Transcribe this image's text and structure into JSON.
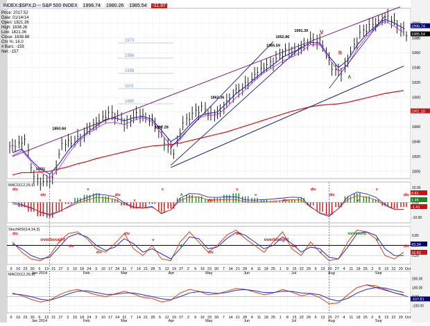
{
  "header": {
    "chart_title": "INDEX:$SPX,D -- S&P 500 INDEX",
    "toolbar_values": [
      "1996.74",
      "1980.26",
      "1985.54",
      "-11.97"
    ],
    "info_lines": [
      "Price: 2017.52",
      "Date: 01/14/14",
      "Open: 1821.36",
      "High: 1838.26",
      "Low: 1821.36",
      "Close: 1838.88",
      "Chr %: 16.0",
      "# Bars: -159",
      "Net: -157"
    ]
  },
  "colors": {
    "up_down_bars": "#000000",
    "ma_short": "#1f2fd0",
    "ma_mid": "#d02fd0",
    "ma_long": "#d01010",
    "channel": "#1a1a8a",
    "upper_trend": "#7a1a7a",
    "histogram_pos": "#1a8a1a",
    "histogram_neg": "#d01010",
    "macd_line": "#1f2fd0",
    "signal_line": "#e04010",
    "annotation_red": "#d01010",
    "annotation_green": "#1a8a1a",
    "annotation_black": "#000000",
    "fib_label": "#5b8fd0",
    "badge_bg": "#000080"
  },
  "chart_data": [
    {
      "type": "line",
      "panel": "price",
      "x_labels": [
        "9",
        "16",
        "23",
        "30",
        "6",
        "13",
        "21",
        "27",
        "3",
        "10",
        "18",
        "24",
        "3",
        "10",
        "17",
        "24",
        "31",
        "7",
        "14",
        "21",
        "28",
        "5",
        "12",
        "19",
        "27",
        "2",
        "9",
        "16",
        "23",
        "30",
        "7",
        "14",
        "21",
        "28",
        "4",
        "11",
        "18",
        "25",
        "1",
        "8",
        "15",
        "22",
        "29",
        "6",
        "13",
        "20",
        "27",
        "4",
        "11",
        "18",
        "25",
        "2",
        "8",
        "15",
        "22",
        "29",
        "Oct"
      ],
      "month_labels": [
        {
          "label": "Jan 2014",
          "index": 3
        },
        {
          "label": "Feb",
          "index": 8
        },
        {
          "label": "Mar",
          "index": 12
        },
        {
          "label": "Apr",
          "index": 17
        },
        {
          "label": "May",
          "index": 21
        },
        {
          "label": "Jun",
          "index": 25
        },
        {
          "label": "Jul",
          "index": 30
        },
        {
          "label": "Aug",
          "index": 34
        },
        {
          "label": "Sep",
          "index": 39
        }
      ],
      "y_ticks": [
        1800,
        1820,
        1840,
        1860,
        1880,
        1900,
        1920,
        1940,
        1960,
        1980,
        2000
      ],
      "ylim": [
        1790,
        2020
      ],
      "weekly_close": [
        1834,
        1842,
        1790,
        1783,
        1790,
        1838,
        1840,
        1846,
        1860,
        1868,
        1878,
        1872,
        1863,
        1878,
        1873,
        1865,
        1840,
        1825,
        1865,
        1876,
        1885,
        1876,
        1880,
        1900,
        1912,
        1920,
        1935,
        1943,
        1950,
        1962,
        1963,
        1970,
        1980,
        1972,
        1940,
        1932,
        1960,
        1985,
        1995,
        2002,
        2010,
        1997,
        1986
      ],
      "ma_short": [
        1825,
        1830,
        1815,
        1803,
        1796,
        1810,
        1828,
        1842,
        1852,
        1861,
        1870,
        1872,
        1868,
        1872,
        1874,
        1870,
        1855,
        1840,
        1848,
        1862,
        1874,
        1878,
        1880,
        1892,
        1905,
        1914,
        1925,
        1935,
        1944,
        1954,
        1960,
        1966,
        1974,
        1973,
        1955,
        1940,
        1950,
        1970,
        1985,
        1996,
        2005,
        2000,
        1993
      ],
      "ma_long": [
        1795,
        1798,
        1798,
        1799,
        1800,
        1803,
        1806,
        1810,
        1813,
        1817,
        1820,
        1823,
        1826,
        1829,
        1832,
        1834,
        1835,
        1836,
        1838,
        1841,
        1844,
        1847,
        1850,
        1853,
        1857,
        1861,
        1865,
        1869,
        1873,
        1877,
        1881,
        1884,
        1887,
        1889,
        1890,
        1891,
        1893,
        1896,
        1899,
        1902,
        1905,
        1907,
        1909
      ],
      "price_labels": [
        {
          "text": "1850.84",
          "index": 5
        },
        {
          "text": "10/31",
          "index": 3
        },
        {
          "text": "1897.28",
          "index": 16
        },
        {
          "text": "1862.36",
          "index": 22
        },
        {
          "text": "1985.59",
          "index": 28
        },
        {
          "text": "1991.39",
          "index": 31
        },
        {
          "text": "1952.86",
          "index": 29
        }
      ],
      "fib_labels": [
        "1973",
        "1956",
        "1939",
        "1101",
        "1885"
      ],
      "wave_labels": [
        "V",
        "A",
        "B"
      ],
      "right_badges": [
        "1996.74",
        "1985.54",
        "1881.10"
      ]
    },
    {
      "type": "bar",
      "panel": "macd_histogram",
      "title": "MACD(12,26,9)",
      "y_ticks": [
        "10.00",
        "0.00",
        "-10.00"
      ],
      "histogram": [
        0,
        -3,
        -6,
        -9,
        -10,
        -6,
        -1,
        3,
        5,
        6,
        4,
        2,
        -2,
        -4,
        -3,
        -1,
        -6,
        -4,
        3,
        5,
        4,
        2,
        3,
        5,
        6,
        4,
        3,
        2,
        1,
        1,
        2,
        3,
        -2,
        -6,
        -8,
        -3,
        4,
        6,
        4,
        2,
        -2,
        -4,
        -3
      ],
      "annotations": [
        "div",
        "div",
        "v",
        "v",
        "div",
        "v",
        "v",
        "A",
        "div",
        "v",
        "v",
        "div",
        "div",
        "div",
        "v",
        "v",
        "div"
      ],
      "right_badges": [
        "8.81",
        "1.45",
        "-1.41"
      ]
    },
    {
      "type": "line",
      "panel": "stochastic",
      "title": "StochRSI(14,14,3)",
      "y_ticks": [
        "0.80",
        "0.50",
        "0.20"
      ],
      "k_line": [
        0.6,
        0.3,
        0.1,
        0.05,
        0.2,
        0.6,
        0.85,
        0.9,
        0.7,
        0.4,
        0.3,
        0.55,
        0.85,
        0.4,
        0.2,
        0.5,
        0.1,
        0.05,
        0.6,
        0.9,
        0.6,
        0.3,
        0.5,
        0.8,
        0.95,
        0.7,
        0.5,
        0.3,
        0.6,
        0.9,
        0.4,
        0.2,
        0.6,
        0.3,
        0.05,
        0.1,
        0.6,
        0.95,
        0.9,
        0.7,
        0.2,
        0.1,
        0.3
      ],
      "d_line": [
        0.55,
        0.4,
        0.2,
        0.1,
        0.15,
        0.45,
        0.75,
        0.85,
        0.75,
        0.5,
        0.35,
        0.45,
        0.7,
        0.55,
        0.3,
        0.4,
        0.25,
        0.1,
        0.4,
        0.75,
        0.7,
        0.4,
        0.45,
        0.7,
        0.88,
        0.8,
        0.6,
        0.4,
        0.5,
        0.75,
        0.55,
        0.3,
        0.45,
        0.4,
        0.15,
        0.1,
        0.45,
        0.85,
        0.9,
        0.8,
        0.4,
        0.2,
        0.2
      ],
      "annotations": [
        "div",
        "overbought",
        "div",
        "div",
        "div",
        "v",
        "A",
        "div",
        "div",
        "overbought",
        "div",
        "v",
        "oversold",
        "A",
        "div"
      ],
      "right_badges": [
        "43.34",
        "16.83"
      ]
    },
    {
      "type": "line",
      "panel": "macd_weekly",
      "title": "MACD(12,26,9)",
      "y_ticks": [
        "200.00",
        "100.00",
        "0.00",
        "-100.00"
      ],
      "macd_line": [
        40,
        10,
        -30,
        -60,
        -40,
        20,
        60,
        80,
        50,
        20,
        0,
        30,
        60,
        30,
        -10,
        -20,
        -60,
        -40,
        40,
        80,
        60,
        20,
        30,
        60,
        90,
        80,
        50,
        20,
        40,
        80,
        50,
        10,
        30,
        -10,
        -80,
        -70,
        20,
        100,
        130,
        120,
        80,
        40,
        20
      ],
      "signal_line": [
        30,
        20,
        0,
        -30,
        -40,
        -10,
        30,
        60,
        65,
        45,
        25,
        25,
        40,
        40,
        20,
        0,
        -25,
        -35,
        0,
        40,
        55,
        45,
        35,
        45,
        70,
        78,
        65,
        45,
        45,
        60,
        58,
        40,
        35,
        20,
        -25,
        -50,
        -20,
        40,
        80,
        100,
        95,
        70,
        45
      ],
      "right_badges": [
        "-107.81"
      ]
    }
  ]
}
